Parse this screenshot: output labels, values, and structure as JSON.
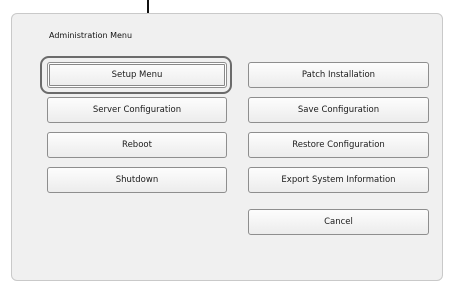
{
  "window": {
    "title": "Administration Menu"
  },
  "buttons_left": [
    {
      "label": "Setup Menu"
    },
    {
      "label": "Server Configuration"
    },
    {
      "label": "Reboot"
    },
    {
      "label": "Shutdown"
    }
  ],
  "buttons_right": [
    {
      "label": "Patch Installation"
    },
    {
      "label": "Save Configuration"
    },
    {
      "label": "Restore Configuration"
    },
    {
      "label": "Export System Information"
    },
    {
      "label": "Cancel"
    }
  ]
}
